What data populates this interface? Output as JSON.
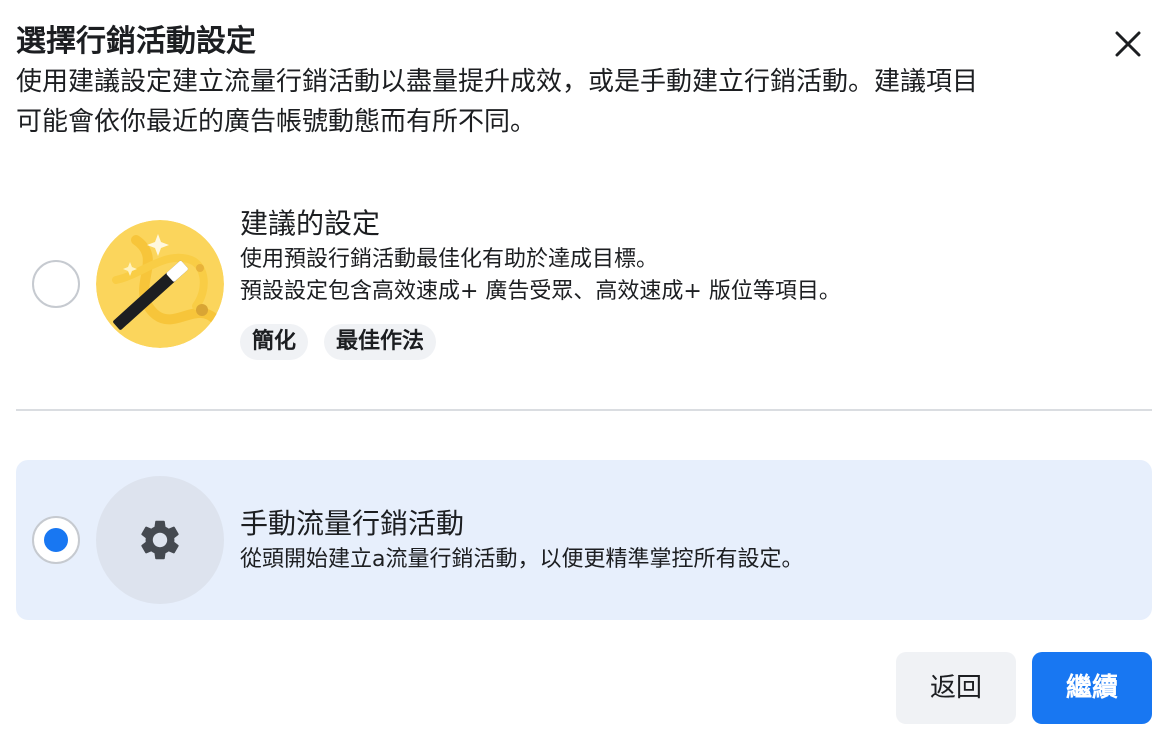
{
  "dialog": {
    "title": "選擇行銷活動設定",
    "description_lines": [
      "使用建議設定建立流量行銷活動以盡量提升成效，或是手動建立行銷活動。建議項目",
      "可能會依你最近的廣告帳號動態而有所不同。"
    ],
    "close_icon": "close-icon"
  },
  "options": [
    {
      "title": "建議的設定",
      "body_lines": [
        "使用預設行銷活動最佳化有助於達成目標。",
        "預設設定包含高效速成+ 廣告受眾、高效速成+ 版位等項目。"
      ],
      "tags": [
        "簡化",
        "最佳作法"
      ],
      "selected": false,
      "icon": "magic-wand-icon",
      "icon_bg": "#fbd55c"
    },
    {
      "title": "手動流量行銷活動",
      "body_lines": [
        "從頭開始建立a流量行銷活動，以便更精準掌控所有設定。"
      ],
      "selected": true,
      "icon": "gear-icon",
      "icon_bg": "#dde3ee"
    }
  ],
  "footer": {
    "back_label": "返回",
    "continue_label": "繼續"
  },
  "colors": {
    "accent": "#1877f2",
    "selected_bg": "#e7effc",
    "secondary_button_bg": "#f0f2f5"
  }
}
